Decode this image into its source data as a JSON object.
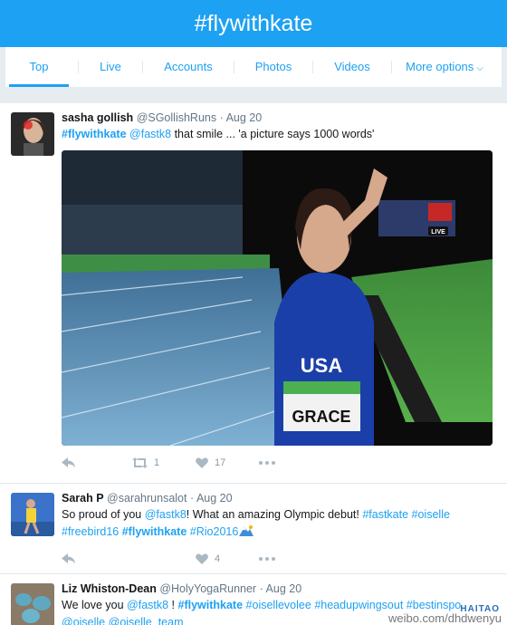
{
  "header": {
    "title": "#flywithkate"
  },
  "tabs": [
    {
      "label": "Top"
    },
    {
      "label": "Live"
    },
    {
      "label": "Accounts"
    },
    {
      "label": "Photos"
    },
    {
      "label": "Videos"
    },
    {
      "label": "More options"
    }
  ],
  "tweets": [
    {
      "name": "sasha gollish",
      "handle": "@SGollishRuns",
      "date": "Aug 20",
      "hashtag": "#flywithkate",
      "mention": "@fastk8",
      "text": " that smile ... 'a picture says 1000 words'",
      "retweets": "1",
      "likes": "17",
      "photo": {
        "bib_country": "USA",
        "bib_name": "GRACE",
        "live_badge": "LIVE"
      }
    },
    {
      "name": "Sarah P",
      "handle": "@sarahrunsalot",
      "date": "Aug 20",
      "t1": "So proud of you ",
      "mention": "@fastk8",
      "t2": "! What an amazing Olympic debut! ",
      "tag1": "#fastkate",
      "tag2": "#oiselle",
      "tag3": "#freebird16",
      "tag4": "#flywithkate",
      "tag5": "#Rio2016",
      "likes": "4"
    },
    {
      "name": "Liz Whiston-Dean",
      "handle": "@HolyYogaRunner",
      "date": "Aug 20",
      "t1": "We love you ",
      "mention": "@fastk8",
      "t2": " ! ",
      "tag1": "#flywithkate",
      "tag2": "#oisellevolee",
      "tag3": "#headupwingsout",
      "tag4": "#bestinspo",
      "mention2": "@oiselle",
      "mention3": "@oiselle_team"
    }
  ],
  "watermark": {
    "text": "weibo.com/dhdwenyu",
    "brand": "HAITAO"
  },
  "dot": "·"
}
